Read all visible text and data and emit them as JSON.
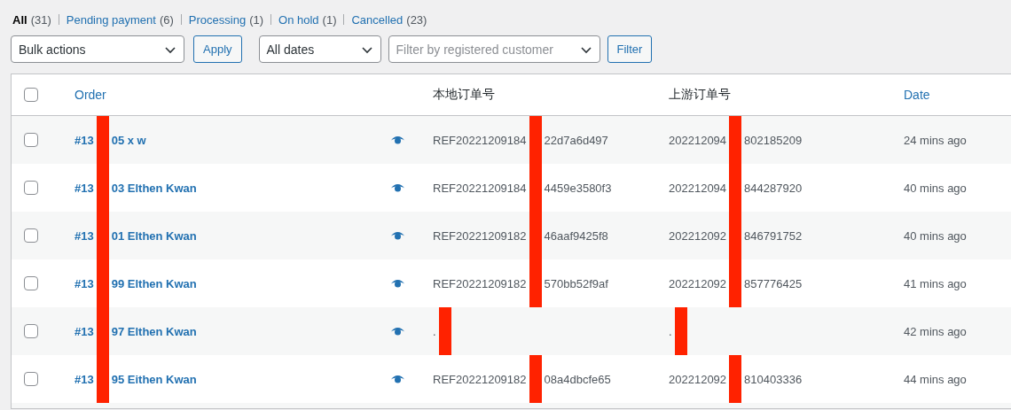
{
  "status_filters": [
    {
      "label": "All",
      "count": "(31)",
      "selected": true
    },
    {
      "label": "Pending payment",
      "count": "(6)",
      "selected": false
    },
    {
      "label": "Processing",
      "count": "(1)",
      "selected": false
    },
    {
      "label": "On hold",
      "count": "(1)",
      "selected": false
    },
    {
      "label": "Cancelled",
      "count": "(23)",
      "selected": false
    }
  ],
  "toolbar": {
    "bulk_actions": {
      "value": "Bulk actions"
    },
    "apply_button": "Apply",
    "date_filter": {
      "value": "All dates"
    },
    "customer_filter": {
      "placeholder": "Filter by registered customer"
    },
    "filter_button": "Filter"
  },
  "table": {
    "select_all": {
      "checked": false
    },
    "columns": [
      {
        "label": "Order",
        "kind": "sortable"
      },
      {
        "label": "本地订单号",
        "kind": "plain"
      },
      {
        "label": "上游订单号",
        "kind": "plain"
      },
      {
        "label": "Date",
        "kind": "sortable"
      }
    ],
    "rows": [
      {
        "checked": false,
        "order": {
          "before": "#13",
          "after": "05 x w"
        },
        "local": {
          "before": "REF20221209184",
          "after": "22d7a6d497"
        },
        "upstream": {
          "before": "202212094",
          "after": "802185209"
        },
        "date": "24 mins ago"
      },
      {
        "checked": false,
        "order": {
          "before": "#13",
          "after": "03 Elthen Kwan"
        },
        "local": {
          "before": "REF20221209184",
          "after": "4459e3580f3"
        },
        "upstream": {
          "before": "202212094",
          "after": "844287920"
        },
        "date": "40 mins ago"
      },
      {
        "checked": false,
        "order": {
          "before": "#13",
          "after": "01 Elthen Kwan"
        },
        "local": {
          "before": "REF20221209182",
          "after": "46aaf9425f8"
        },
        "upstream": {
          "before": "202212092",
          "after": "846791752"
        },
        "date": "40 mins ago"
      },
      {
        "checked": false,
        "order": {
          "before": "#13",
          "after": "99 Elthen Kwan"
        },
        "local": {
          "before": "REF20221209182",
          "after": "570bb52f9af"
        },
        "upstream": {
          "before": "202212092",
          "after": "857776425"
        },
        "date": "41 mins ago"
      },
      {
        "checked": false,
        "order": {
          "before": "#13",
          "after": "97 Elthen Kwan"
        },
        "local": {
          "before": "."
        },
        "upstream": {
          "before": "."
        },
        "date": "42 mins ago"
      },
      {
        "checked": false,
        "order": {
          "before": "#13",
          "after": "95 Eithen Kwan"
        },
        "local": {
          "before": "REF20221209182",
          "after": "08a4dbcfe65"
        },
        "upstream": {
          "before": "202212092",
          "after": "810403336"
        },
        "date": "44 mins ago"
      }
    ]
  }
}
